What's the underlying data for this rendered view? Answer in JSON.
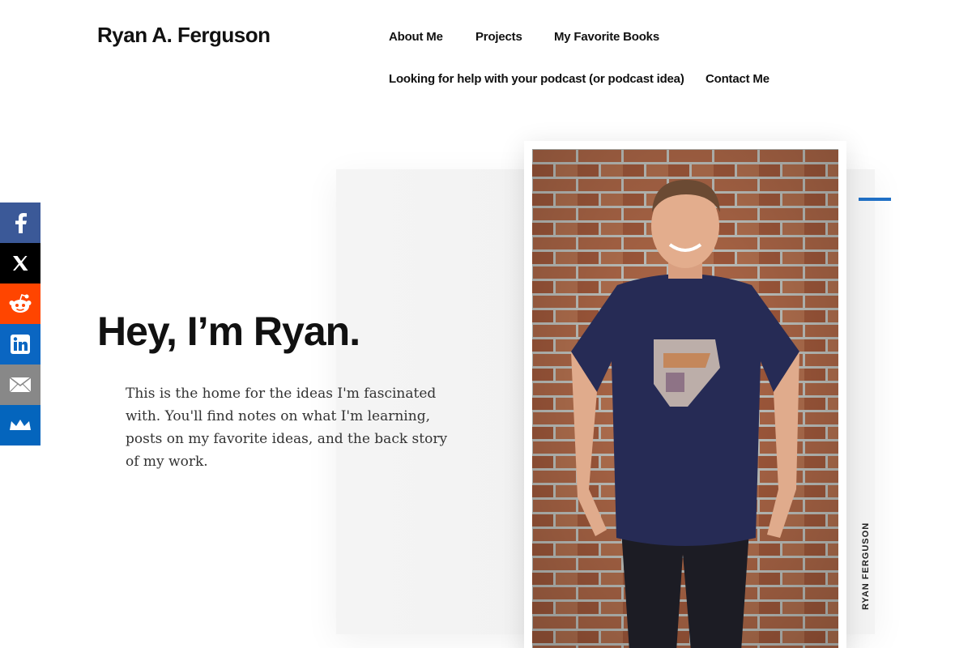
{
  "header": {
    "site_title": "Ryan A. Ferguson",
    "nav": [
      {
        "label": "About Me"
      },
      {
        "label": "Projects"
      },
      {
        "label": "My Favorite Books"
      },
      {
        "label": "Looking for help with your podcast (or podcast idea)"
      },
      {
        "label": "Contact Me"
      }
    ]
  },
  "hero": {
    "heading": "Hey, I’m Ryan.",
    "intro": "This is the home for the ideas I'm fascinated with. You'll find notes on what I'm learning, posts on my favorite ideas, and the back story of my work.",
    "vertical_label": "RYAN FERGUSON",
    "photo_icon": "portrait-photo"
  },
  "share": [
    {
      "name": "facebook",
      "icon": "facebook-icon",
      "color": "#3b5998"
    },
    {
      "name": "x",
      "icon": "x-icon",
      "color": "#000000"
    },
    {
      "name": "reddit",
      "icon": "reddit-icon",
      "color": "#ff4500"
    },
    {
      "name": "linkedin",
      "icon": "linkedin-icon",
      "color": "#0a66c2"
    },
    {
      "name": "email",
      "icon": "email-icon",
      "color": "#888888"
    },
    {
      "name": "sumo",
      "icon": "sumo-icon",
      "color": "#0465bd"
    }
  ],
  "colors": {
    "accent": "#1f6fc5",
    "panel": "#f3f3f3"
  }
}
